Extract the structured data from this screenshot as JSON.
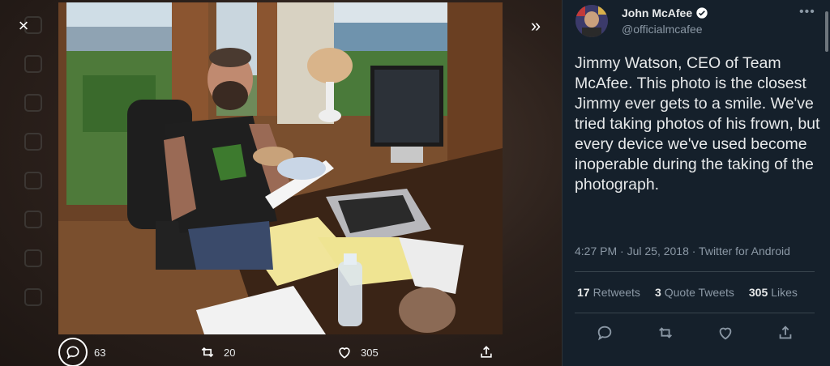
{
  "modal": {
    "close_label": "×",
    "expand_label": "»"
  },
  "media_actions": {
    "reply_count": "63",
    "retweet_count": "20",
    "like_count": "305"
  },
  "tweet": {
    "author_name": "John McAfee",
    "author_handle": "@officialmcafee",
    "more_label": "•••",
    "text": "Jimmy Watson, CEO of Team McAfee. This photo is the closest Jimmy ever gets to a smile. We've tried taking photos of his frown, but every device we've used become inoperable during the taking of the photograph.",
    "meta": "4:27 PM · Jul 25, 2018 · Twitter for Android",
    "stats": {
      "retweets_count": "17",
      "retweets_label": "Retweets",
      "quotes_count": "3",
      "quotes_label": "Quote Tweets",
      "likes_count": "305",
      "likes_label": "Likes"
    }
  },
  "colors": {
    "accent": "#1d9bf0",
    "pane_bg": "#15202b",
    "muted_text": "#8b98a5"
  }
}
